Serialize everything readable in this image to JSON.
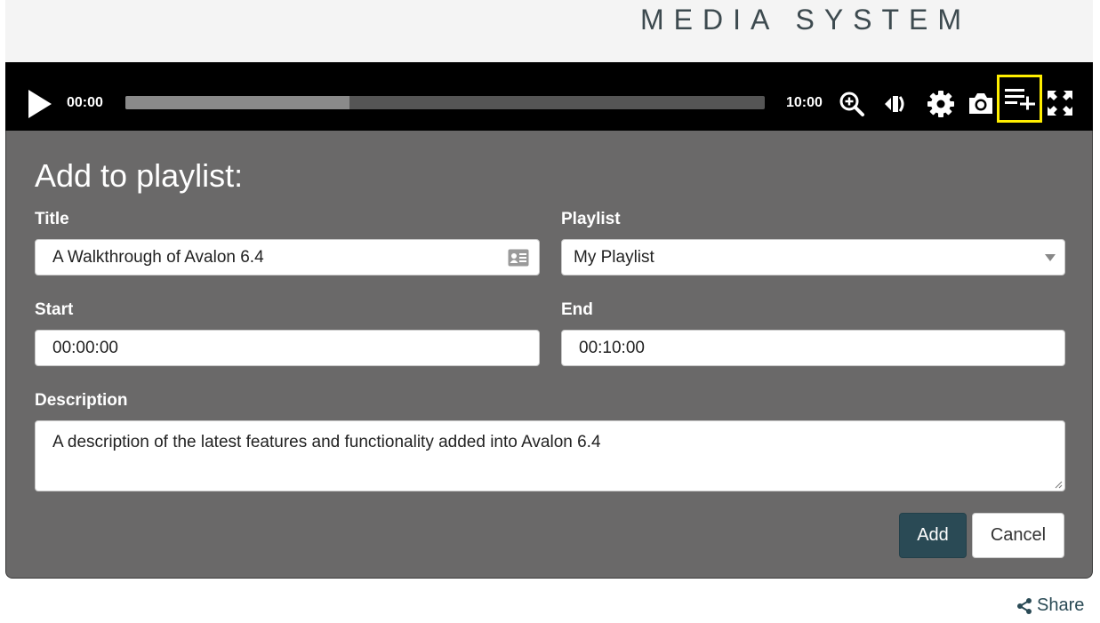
{
  "header": {
    "brand": "MEDIA SYSTEM"
  },
  "player": {
    "current_time": "00:00",
    "total_time": "10:00",
    "buffered_fraction": 0.35,
    "highlight_color": "#ffee00",
    "icons": [
      "play-icon",
      "zoom-in-icon",
      "volume-icon",
      "gear-icon",
      "camera-icon",
      "add-to-playlist-icon",
      "fullscreen-icon"
    ]
  },
  "form": {
    "heading": "Add to playlist:",
    "title": {
      "label": "Title",
      "value": "A Walkthrough of Avalon 6.4"
    },
    "playlist": {
      "label": "Playlist",
      "selected": "My Playlist"
    },
    "start": {
      "label": "Start",
      "value": "00:00:00"
    },
    "end": {
      "label": "End",
      "value": "00:10:00"
    },
    "description": {
      "label": "Description",
      "value": "A description of the latest features and functionality added into Avalon 6.4"
    },
    "add_label": "Add",
    "cancel_label": "Cancel"
  },
  "share": {
    "label": "Share"
  },
  "colors": {
    "panel_background": "#6a6969",
    "primary_button": "#2a4a55",
    "player_background": "#000000"
  }
}
